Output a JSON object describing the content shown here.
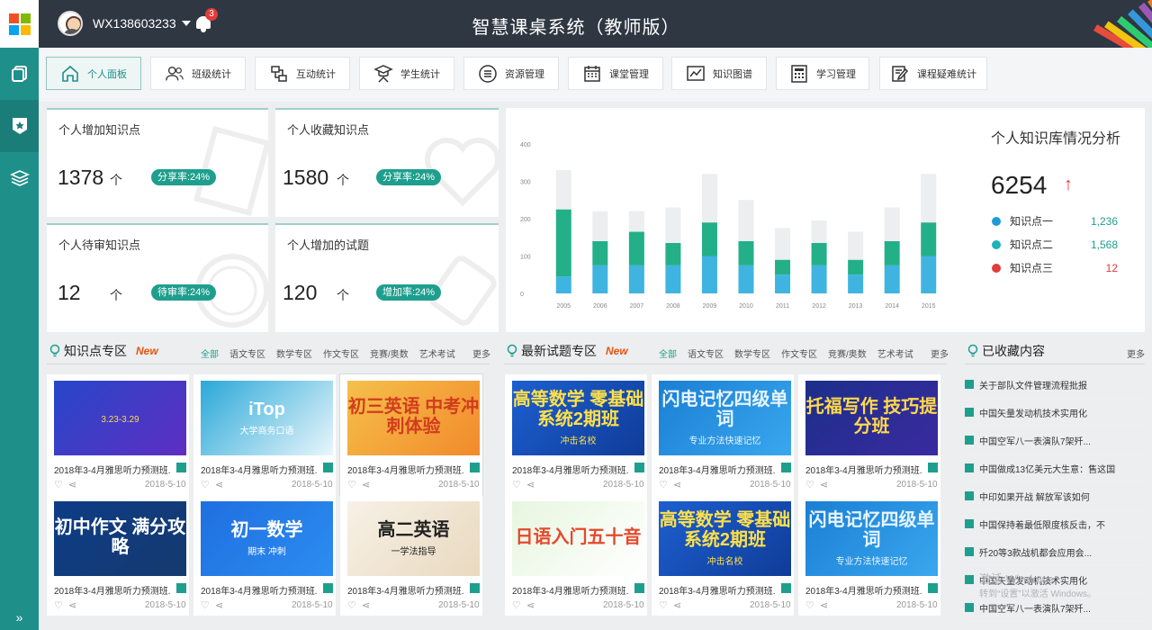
{
  "app": {
    "title": "智慧课桌系统（教师版）",
    "user": "WX138603233",
    "notify_count": "3"
  },
  "colors": {
    "accent": "#1e9f8e",
    "sidebar": "#1f8f8a",
    "topbar": "#2f3742",
    "series": [
      "#3fb4e0",
      "#23b089",
      "#eceeef"
    ]
  },
  "sidebar": {
    "items": [
      {
        "icon": "copy-icon"
      },
      {
        "icon": "star-badge-icon"
      },
      {
        "icon": "layers-icon"
      }
    ],
    "expand": "»"
  },
  "nav": {
    "items": [
      {
        "label": "个人面板",
        "icon": "home-icon",
        "active": true
      },
      {
        "label": "班级统计",
        "icon": "users-icon"
      },
      {
        "label": "互动统计",
        "icon": "interaction-icon"
      },
      {
        "label": "学生统计",
        "icon": "student-icon"
      },
      {
        "label": "资源管理",
        "icon": "list-circle-icon"
      },
      {
        "label": "课堂管理",
        "icon": "calendar-icon"
      },
      {
        "label": "知识图谱",
        "icon": "graph-icon"
      },
      {
        "label": "学习管理",
        "icon": "calculator-icon"
      },
      {
        "label": "课程疑难统计",
        "icon": "edit-doc-icon"
      }
    ]
  },
  "stats": [
    {
      "label": "个人增加知识点",
      "value": "1378",
      "unit": "个",
      "tag": "分享率:24%"
    },
    {
      "label": "个人收藏知识点",
      "value": "1580",
      "unit": "个",
      "tag": "分享率:24%"
    },
    {
      "label": "个人待审知识点",
      "value": "12",
      "unit": "个",
      "tag": "待审率:24%"
    },
    {
      "label": "个人增加的试题",
      "value": "120",
      "unit": "个",
      "tag": "增加率:24%"
    }
  ],
  "knowledge": {
    "title": "个人知识库情况分析",
    "total": "6254",
    "arrow": "↑",
    "legend": [
      {
        "name": "知识点一",
        "value": "1,236",
        "color": "#1e9bd7"
      },
      {
        "name": "知识点二",
        "value": "1,568",
        "color": "#1eb3b8"
      },
      {
        "name": "知识点三",
        "value": "12",
        "color": "#e23b3b"
      }
    ]
  },
  "chart_data": {
    "type": "bar",
    "stacked": true,
    "categories": [
      "2005",
      "2006",
      "2007",
      "2008",
      "2009",
      "2010",
      "2011",
      "2012",
      "2013",
      "2014",
      "2015"
    ],
    "series": [
      {
        "values": [
          45,
          75,
          75,
          75,
          100,
          75,
          50,
          75,
          50,
          75,
          100
        ]
      },
      {
        "values": [
          180,
          65,
          90,
          60,
          90,
          65,
          40,
          60,
          40,
          65,
          90
        ]
      },
      {
        "values": [
          105,
          80,
          55,
          95,
          130,
          110,
          85,
          60,
          75,
          90,
          130
        ]
      }
    ],
    "yticks": [
      "0",
      "100",
      "200",
      "300",
      "400"
    ],
    "ylim": [
      0,
      400
    ]
  },
  "sections": {
    "knowledge": {
      "title": "知识点专区",
      "new": "New",
      "tabs": [
        "全部",
        "语文专区",
        "数学专区",
        "作文专区",
        "竞赛/奥数",
        "艺术考试"
      ],
      "more": "更多"
    },
    "exams": {
      "title": "最新试题专区",
      "new": "New",
      "tabs": [
        "全部",
        "语文专区",
        "数学专区",
        "作文专区",
        "竞赛/奥数",
        "艺术考试"
      ],
      "more": "更多"
    },
    "favorites": {
      "title": "已收藏内容",
      "more": "更多"
    }
  },
  "cards": {
    "caption": "2018年3-4月雅思听力预测班...",
    "date": "2018-5-10",
    "thumbs": [
      {
        "text": "",
        "sub": "3.23-3.29"
      },
      {
        "text": "iTop",
        "sub": "大学商务口语"
      },
      {
        "text": "初三英语 中考冲刺体验",
        "sub": ""
      },
      {
        "text": "初中作文 满分攻略",
        "sub": ""
      },
      {
        "text": "初一数学",
        "sub": "期末 冲刺"
      },
      {
        "text": "高二英语",
        "sub": "一学法指导"
      },
      {
        "text": "高等数学 零基础系统2期班",
        "sub": "冲击名校"
      },
      {
        "text": "闪电记忆四级单词",
        "sub": "专业方法快速记忆"
      },
      {
        "text": "托福写作 技巧提分班",
        "sub": ""
      },
      {
        "text": "日语入门五十音",
        "sub": ""
      },
      {
        "text": "高等数学 零基础系统2期班",
        "sub": "冲击名校"
      },
      {
        "text": "闪电记忆四级单词",
        "sub": "专业方法快速记忆"
      }
    ]
  },
  "favorites": [
    "关于部队文件管理流程批报",
    "中国矢量发动机技术实用化",
    "中国空军八一表演队7架歼...",
    "中国做成13亿美元大生意：售这国",
    "中印如果开战 解放军该如何",
    "中国保持着最低限度核反击，不",
    "歼20等3款战机都会应用会...",
    "中国矢量发动机技术实用化",
    "中国空军八一表演队7架歼..."
  ],
  "watermark": {
    "line1": "激活 Windows",
    "line2": "转到“设置”以激活 Windows。"
  }
}
